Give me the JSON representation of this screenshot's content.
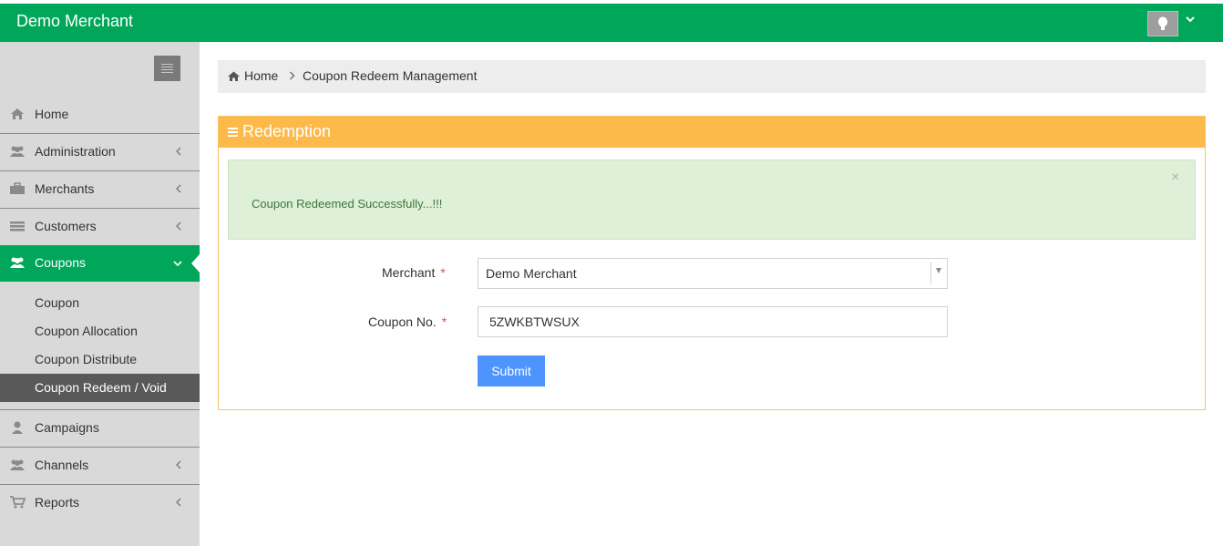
{
  "header": {
    "brand": "Demo Merchant",
    "avatar_icon": "lightbulb-icon",
    "menu_icon": "chevron-down-icon",
    "color": "#00a65a"
  },
  "sidebar": {
    "toggle_icon": "hamburger-icon",
    "items": [
      {
        "label": "Home",
        "icon": "home-icon"
      },
      {
        "label": "Administration",
        "icon": "users-icon"
      },
      {
        "label": "Merchants",
        "icon": "briefcase-icon"
      },
      {
        "label": "Customers",
        "icon": "list-icon"
      },
      {
        "label": "Coupons",
        "icon": "users-icon"
      },
      {
        "label": "Campaigns",
        "icon": "user-icon"
      },
      {
        "label": "Channels",
        "icon": "users-icon"
      },
      {
        "label": "Reports",
        "icon": "cart-icon"
      }
    ],
    "coupon_submenu": [
      {
        "label": "Coupon"
      },
      {
        "label": "Coupon Allocation"
      },
      {
        "label": "Coupon Distribute"
      },
      {
        "label": "Coupon Redeem / Void"
      }
    ]
  },
  "breadcrumb": {
    "home": "Home",
    "separator": ">",
    "page": "Coupon Redeem Management"
  },
  "panel": {
    "title": "Redemption",
    "header_color": "#fdb94a",
    "alert": {
      "message": "Coupon Redeemed Successfully...!!!",
      "close": "×"
    },
    "form": {
      "merchant_label": "Merchant",
      "merchant_value": "Demo Merchant",
      "coupon_label": "Coupon No.",
      "coupon_value": "5ZWKBTWSUX",
      "required_mark": "*",
      "submit_label": "Submit"
    }
  }
}
